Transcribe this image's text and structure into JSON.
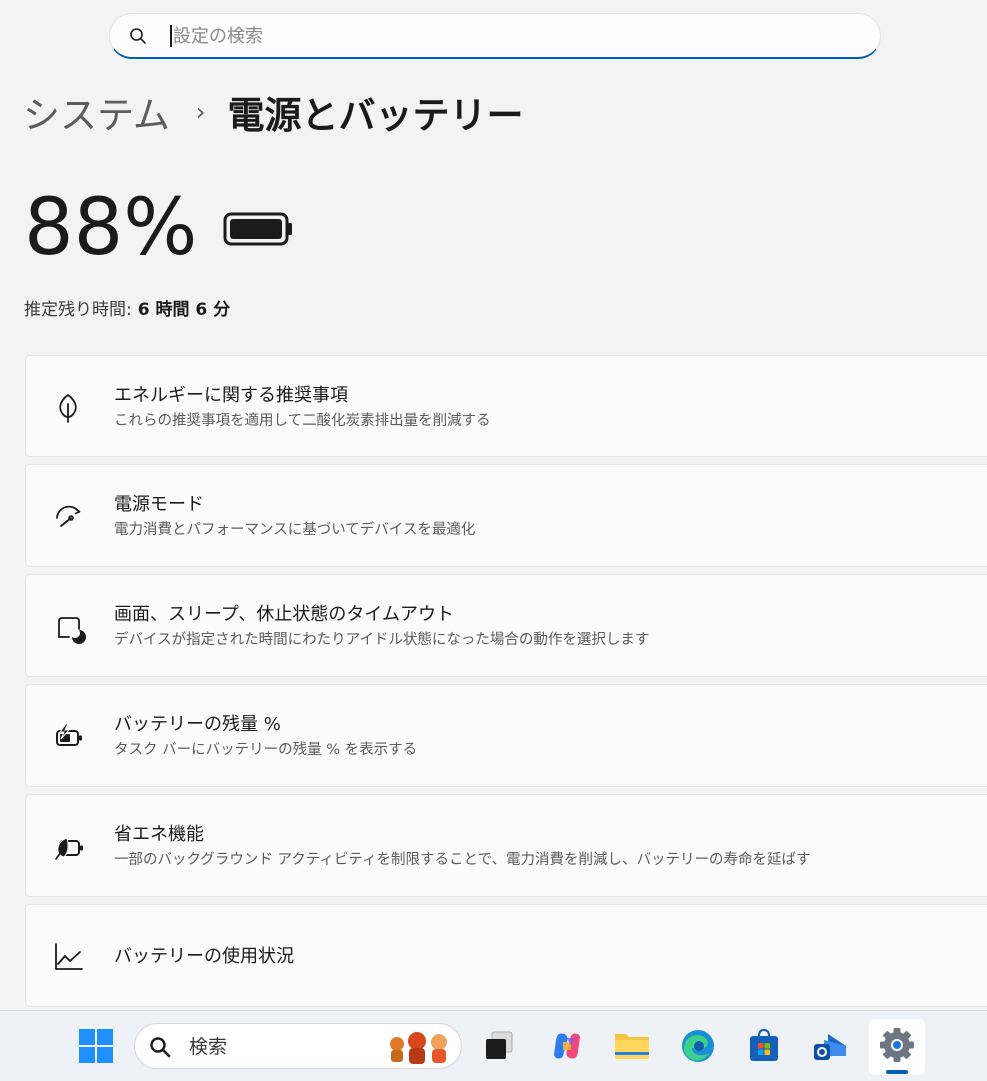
{
  "search": {
    "placeholder": "設定の検索"
  },
  "breadcrumb": {
    "parent": "システム",
    "separator": "›",
    "current": "電源とバッテリー"
  },
  "battery": {
    "percent_text": "88%",
    "level": 0.88,
    "remaining_label": "推定残り時間:",
    "remaining_value": "6 時間 6 分"
  },
  "settings": [
    {
      "title": "エネルギーに関する推奨事項",
      "description": "これらの推奨事項を適用して二酸化炭素排出量を削減する",
      "icon": "leaf-icon"
    },
    {
      "title": "電源モード",
      "description": "電力消費とパフォーマンスに基づいてデバイスを最適化",
      "icon": "gauge-icon"
    },
    {
      "title": "画面、スリープ、休止状態のタイムアウト",
      "description": "デバイスが指定された時間にわたりアイドル状態になった場合の動作を選択します",
      "icon": "screen-sleep-icon"
    },
    {
      "title": "バッテリーの残量 %",
      "description": "タスク バーにバッテリーの残量 % を表示する",
      "icon": "battery-charging-icon"
    },
    {
      "title": "省エネ機能",
      "description": "一部のバックグラウンド アクティビティを制限することで、電力消費を削減し、バッテリーの寿命を延ばす",
      "icon": "battery-saver-icon"
    },
    {
      "title": "バッテリーの使用状況",
      "description": "",
      "icon": "usage-chart-icon"
    }
  ],
  "taskbar": {
    "search_text": "検索",
    "items": [
      "start-icon",
      "task-view-icon",
      "copilot-icon",
      "file-explorer-icon",
      "edge-icon",
      "store-icon",
      "outlook-icon",
      "settings-icon"
    ],
    "active": "settings-icon"
  }
}
